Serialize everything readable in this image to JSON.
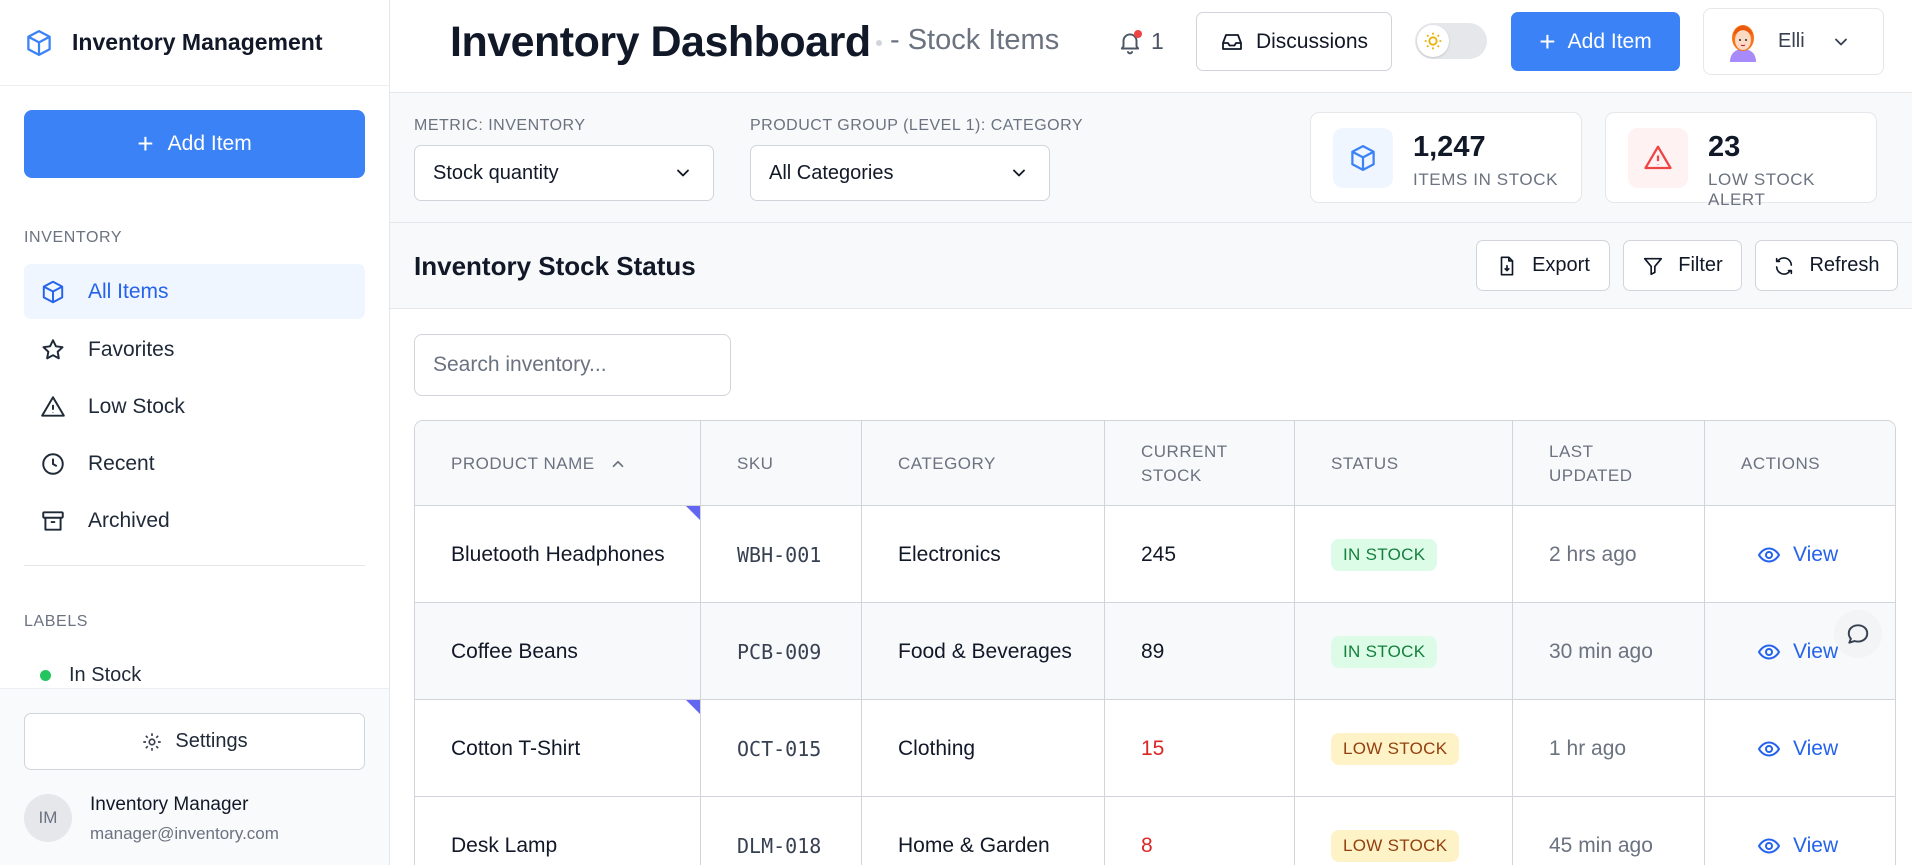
{
  "sidebar": {
    "brand_title": "Inventory Management",
    "add_label": "Add Item",
    "section_inventory": "INVENTORY",
    "items": [
      {
        "label": "All Items",
        "icon": "cube-icon",
        "active": true
      },
      {
        "label": "Favorites",
        "icon": "star-icon"
      },
      {
        "label": "Low Stock",
        "icon": "warning-icon"
      },
      {
        "label": "Recent",
        "icon": "clock-icon"
      },
      {
        "label": "Archived",
        "icon": "archive-icon"
      }
    ],
    "section_labels": "LABELS",
    "labels": [
      {
        "label": "In Stock",
        "color": "#22c55e"
      }
    ],
    "settings_label": "Settings",
    "user": {
      "initials": "IM",
      "name": "Inventory Manager",
      "email": "manager@inventory.com"
    }
  },
  "header": {
    "title": "Inventory Dashboard",
    "subtitle": "- Stock Items",
    "notifications": "1",
    "discussions_label": "Discussions",
    "add_label": "Add Item",
    "user_name": "Elli"
  },
  "filters": {
    "metric_label": "METRIC: INVENTORY",
    "metric_value": "Stock quantity",
    "group_label": "PRODUCT GROUP (LEVEL 1): CATEGORY",
    "group_value": "All Categories"
  },
  "stats": [
    {
      "value": "1,247",
      "label": "ITEMS IN STOCK",
      "icon": "cube-icon",
      "color": "#3b82f6"
    },
    {
      "value": "23",
      "label": "LOW STOCK ALERT",
      "icon": "warning-icon",
      "color": "#ef4444"
    }
  ],
  "section": {
    "title": "Inventory Stock Status",
    "export_label": "Export",
    "filter_label": "Filter",
    "refresh_label": "Refresh"
  },
  "search": {
    "placeholder": "Search inventory..."
  },
  "table": {
    "headers": [
      "PRODUCT NAME",
      "SKU",
      "CATEGORY",
      "CURRENT STOCK",
      "STATUS",
      "LAST UPDATED",
      "ACTIONS"
    ],
    "header_lines": {
      "current_stock": [
        "CURRENT",
        "STOCK"
      ],
      "last_updated": [
        "LAST",
        "UPDATED"
      ]
    },
    "rows": [
      {
        "name": "Bluetooth Headphones",
        "sku": "WBH-001",
        "category": "Electronics",
        "stock": "245",
        "status": "IN STOCK",
        "updated": "2 hrs ago",
        "action": "View"
      },
      {
        "name": "Coffee Beans",
        "sku": "PCB-009",
        "category": "Food & Beverages",
        "stock": "89",
        "status": "IN STOCK",
        "updated": "30 min ago",
        "action": "View"
      },
      {
        "name": "Cotton T-Shirt",
        "sku": "OCT-015",
        "category": "Clothing",
        "stock": "15",
        "status": "LOW STOCK",
        "updated": "1 hr ago",
        "action": "View"
      },
      {
        "name": "Desk Lamp",
        "sku": "DLM-018",
        "category": "Home & Garden",
        "stock": "8",
        "status": "LOW STOCK",
        "updated": "45 min ago",
        "action": "View"
      }
    ]
  },
  "colors": {
    "accent": "#3b82f6",
    "link": "#2563eb",
    "in_stock": "#15803d",
    "low_stock": "#92400e",
    "danger": "#dc2626"
  }
}
